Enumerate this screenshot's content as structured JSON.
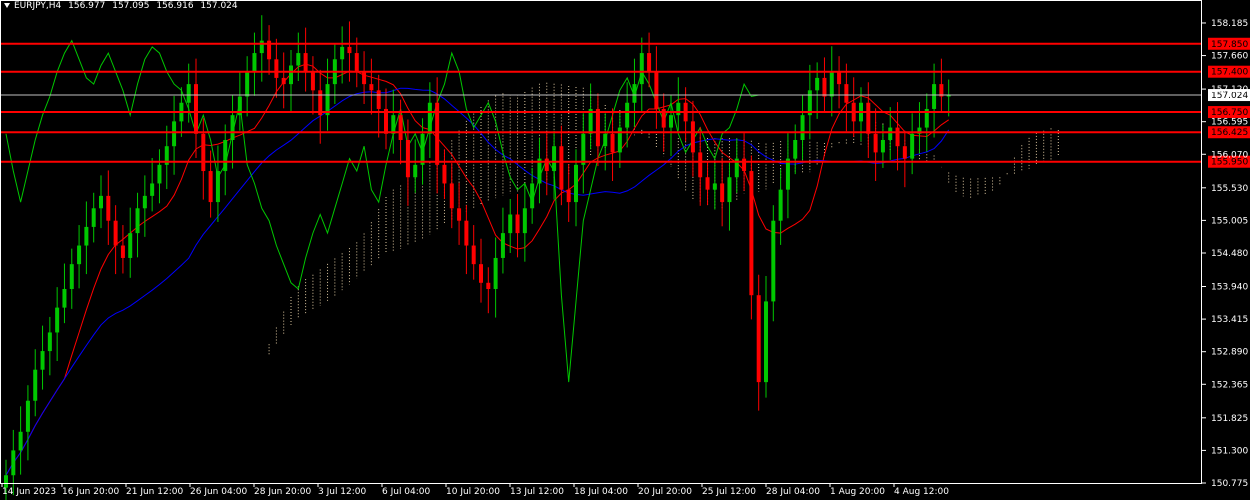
{
  "header": {
    "symbol": "EURJPY,H4",
    "open": "156.977",
    "high": "157.095",
    "low": "156.916",
    "close": "157.024"
  },
  "colors": {
    "background": "#000000",
    "axis": "#ffffff",
    "bull": "#00c800",
    "bear": "#ff0000",
    "level_line": "#ff0000",
    "tenkan": "#ff0000",
    "kijun": "#0000ff",
    "chikou": "#00c800",
    "kumo": "#f5deb3",
    "price_line": "#c0c0c0"
  },
  "chart_data": {
    "type": "candlestick",
    "symbol": "EURJPY",
    "timeframe": "H4",
    "ylim": [
      150.775,
      158.555
    ],
    "y_ticks": [
      "158.185",
      "157.660",
      "157.120",
      "156.595",
      "156.070",
      "155.530",
      "155.005",
      "154.480",
      "153.940",
      "153.415",
      "152.890",
      "152.365",
      "151.825",
      "151.300",
      "150.775"
    ],
    "x_ticks": [
      "14 Jun 2023",
      "16 Jun 20:00",
      "21 Jun 12:00",
      "26 Jun 04:00",
      "28 Jun 20:00",
      "3 Jul 12:00",
      "6 Jul 04:00",
      "10 Jul 20:00",
      "13 Jul 12:00",
      "18 Jul 04:00",
      "20 Jul 20:00",
      "25 Jul 12:00",
      "28 Jul 04:00",
      "1 Aug 20:00",
      "4 Aug 12:00"
    ],
    "levels": [
      {
        "value": 157.85,
        "label": "157.850"
      },
      {
        "value": 157.4,
        "label": "157.400"
      },
      {
        "value": 156.75,
        "label": "156.750"
      },
      {
        "value": 156.425,
        "label": "156.425"
      },
      {
        "value": 155.95,
        "label": "155.950"
      }
    ],
    "current_price": {
      "value": 157.024,
      "label": "157.024"
    },
    "closes": [
      150.9,
      151.3,
      151.6,
      152.1,
      152.6,
      152.9,
      153.2,
      153.6,
      153.9,
      154.3,
      154.6,
      154.9,
      155.2,
      155.4,
      155.0,
      154.6,
      154.4,
      154.8,
      155.2,
      155.4,
      155.6,
      155.9,
      156.2,
      156.6,
      156.9,
      157.2,
      156.4,
      155.8,
      155.3,
      155.8,
      156.3,
      156.7,
      157.0,
      157.4,
      157.7,
      157.9,
      157.6,
      157.3,
      157.2,
      157.5,
      157.7,
      157.4,
      157.1,
      156.7,
      157.2,
      157.6,
      157.8,
      157.7,
      157.4,
      157.2,
      157.1,
      156.8,
      156.4,
      156.7,
      156.3,
      155.7,
      155.9,
      156.4,
      156.9,
      155.9,
      155.6,
      155.2,
      155.0,
      154.6,
      154.3,
      154.0,
      153.9,
      154.4,
      154.8,
      155.1,
      154.8,
      155.2,
      155.6,
      156.0,
      155.8,
      156.2,
      155.5,
      155.3,
      155.9,
      156.4,
      156.8,
      156.2,
      156.4,
      156.1,
      156.5,
      156.9,
      157.2,
      157.7,
      157.4,
      156.8,
      156.5,
      156.7,
      156.9,
      156.6,
      156.1,
      155.7,
      155.5,
      155.6,
      155.3,
      155.7,
      156.0,
      155.8,
      153.8,
      152.4,
      153.7,
      155.0,
      155.5,
      156.0,
      156.3,
      156.7,
      157.1,
      157.3,
      157.0,
      157.4,
      157.2,
      156.9,
      156.6,
      156.9,
      156.4,
      156.1,
      156.3,
      156.5,
      156.2,
      156.0,
      156.4,
      156.5,
      156.8,
      157.2,
      157.0,
      157.024
    ]
  }
}
